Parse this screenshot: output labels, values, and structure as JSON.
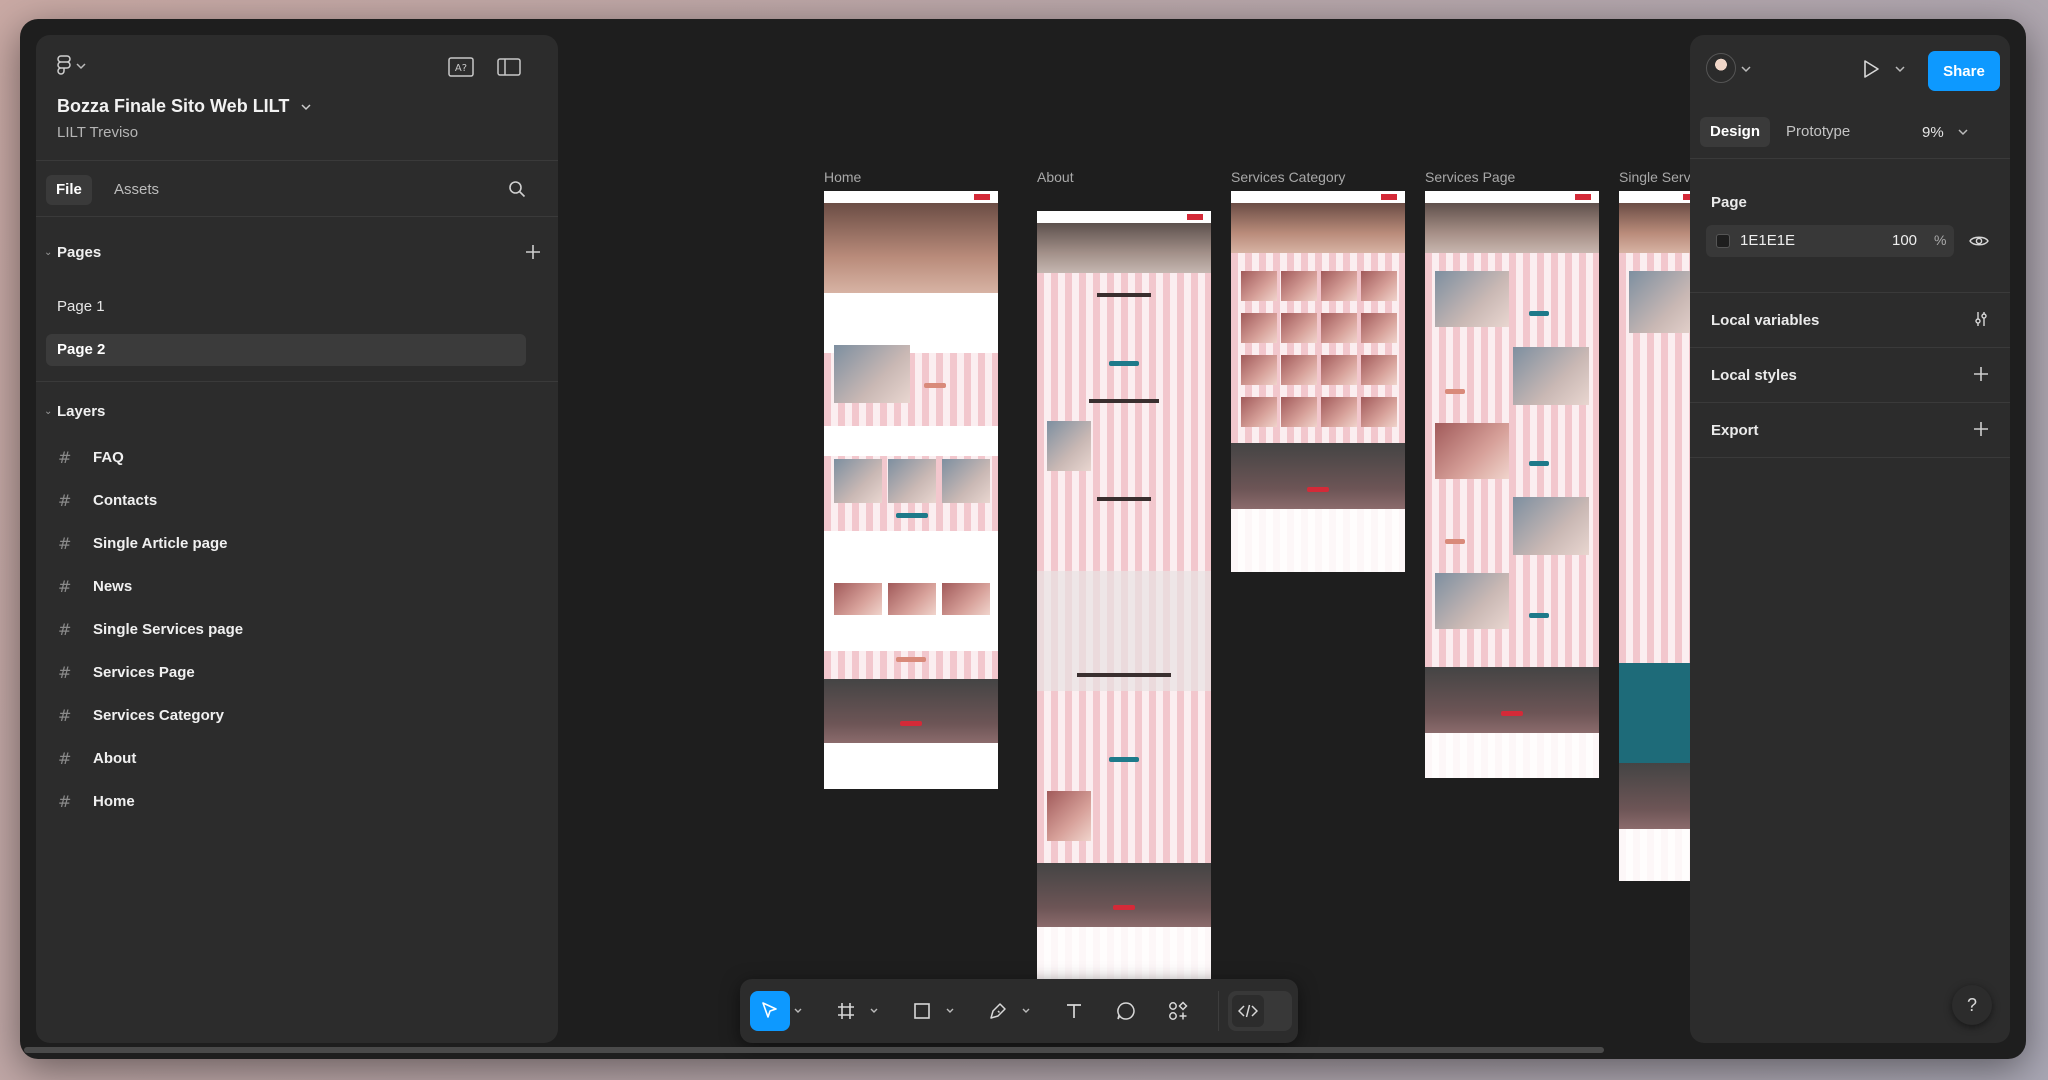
{
  "file": {
    "title": "Bozza Finale Sito Web LILT",
    "subtitle": "LILT Treviso"
  },
  "left_panel": {
    "tabs": [
      "File",
      "Assets"
    ],
    "pages_label": "Pages",
    "pages": [
      "Page 1",
      "Page 2"
    ],
    "selected_page": "Page 2",
    "layers_label": "Layers",
    "layers": [
      "FAQ",
      "Contacts",
      "Single Article page",
      "News",
      "Single Services page",
      "Services Page",
      "Services Category",
      "About",
      "Home"
    ]
  },
  "canvas": {
    "background": "#1E1E1E",
    "frames": [
      {
        "label": "Home"
      },
      {
        "label": "About"
      },
      {
        "label": "Services Category"
      },
      {
        "label": "Services Page"
      },
      {
        "label": "Single Servic"
      }
    ]
  },
  "right_panel": {
    "share_label": "Share",
    "tabs": [
      "Design",
      "Prototype"
    ],
    "zoom": "9%",
    "page_section": {
      "title": "Page",
      "color_hex": "1E1E1E",
      "opacity": "100",
      "opacity_unit": "%"
    },
    "sections": [
      "Local variables",
      "Local styles",
      "Export"
    ]
  },
  "toolbar": {
    "tools": [
      "move-tool",
      "frame-tool",
      "shape-tool",
      "pen-tool",
      "text-tool",
      "comment-tool",
      "actions-tool"
    ],
    "active_tool": "move-tool"
  },
  "help_label": "?",
  "colors": {
    "accent": "#0D99FF",
    "panel": "#2C2C2C",
    "canvas": "#1E1E1E",
    "brand_red": "#D42A38"
  }
}
